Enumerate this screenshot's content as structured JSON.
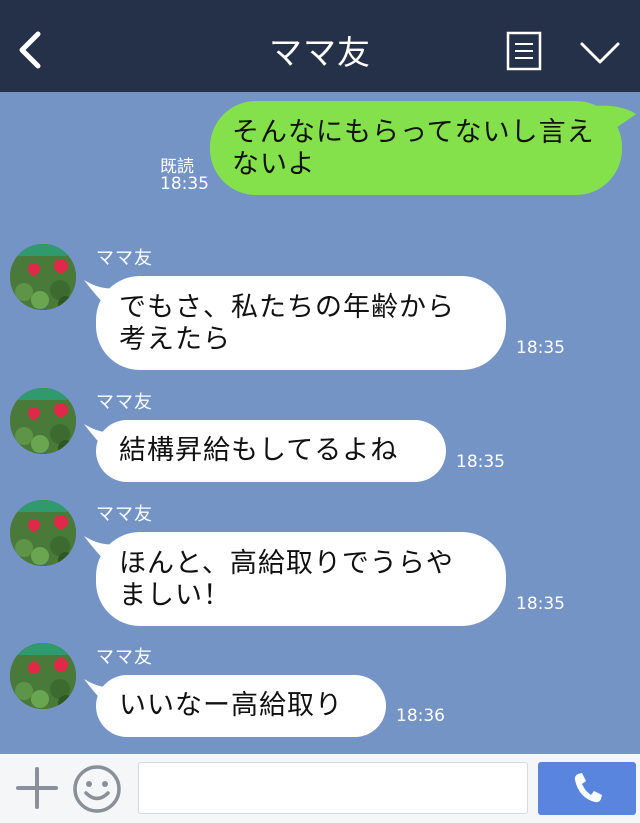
{
  "header": {
    "title": "ママ友",
    "back_icon": "chevron-left-icon",
    "menu_icon": "menu-lines-icon",
    "down_icon": "chevron-down-icon",
    "background_color": "#253049"
  },
  "chat": {
    "background_color": "#7494c6",
    "sent": {
      "text": "そんなにもらってないし言えないよ",
      "read_label": "既読",
      "time": "18:35",
      "bubble_color": "#84e14b"
    },
    "received": [
      {
        "sender": "ママ友",
        "text": "でもさ、私たちの年齢から\n考えたら",
        "time": "18:35"
      },
      {
        "sender": "ママ友",
        "text": "結構昇給もしてるよね",
        "time": "18:35"
      },
      {
        "sender": "ママ友",
        "text": "ほんと、高給取りでうらや\nましい！",
        "time": "18:35"
      },
      {
        "sender": "ママ友",
        "text": "いいなー高給取り",
        "time": "18:36"
      }
    ]
  },
  "input_bar": {
    "plus_icon": "plus-icon",
    "emoji_icon": "smiley-icon",
    "call_icon": "phone-icon",
    "message_value": "",
    "call_button_color": "#5a85de"
  }
}
